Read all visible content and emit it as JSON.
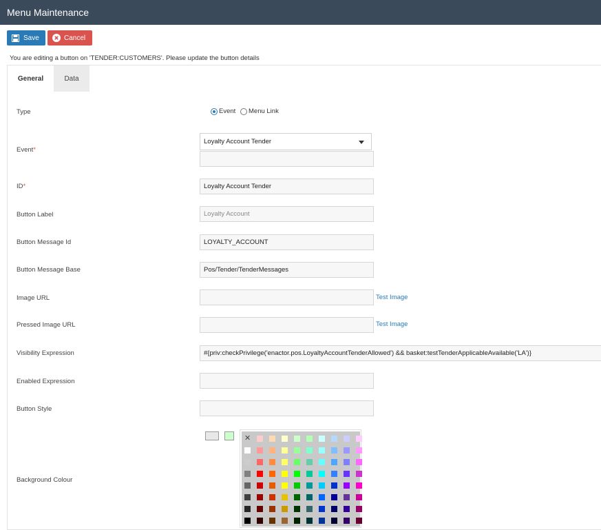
{
  "window": {
    "title": "Menu Maintenance"
  },
  "toolbar": {
    "save_label": "Save",
    "cancel_label": "Cancel"
  },
  "notice": "You are editing a button on 'TENDER:CUSTOMERS'. Please update the button details",
  "tabs": [
    {
      "label": "General",
      "active": true
    },
    {
      "label": "Data",
      "active": false
    }
  ],
  "form": {
    "type": {
      "label": "Type",
      "options": [
        "Event",
        "Menu Link"
      ],
      "selected": "Event"
    },
    "event": {
      "label": "Event",
      "required": "*",
      "selected": "Loyalty Account Tender",
      "sub_value": ""
    },
    "id": {
      "label": "ID",
      "required": "*",
      "value": "Loyalty Account Tender"
    },
    "button_label": {
      "label": "Button Label",
      "placeholder": "Loyalty Account",
      "value": ""
    },
    "button_message_id": {
      "label": "Button Message Id",
      "value": "LOYALTY_ACCOUNT"
    },
    "button_message_base": {
      "label": "Button Message Base",
      "value": "Pos/Tender/TenderMessages"
    },
    "image_url": {
      "label": "Image URL",
      "value": "",
      "test_link": "Test Image"
    },
    "pressed_image_url": {
      "label": "Pressed Image URL",
      "value": "",
      "test_link": "Test Image"
    },
    "visibility_expression": {
      "label": "Visibility Expression",
      "value": "#{priv:checkPrivilege('enactor.pos.LoyaltyAccountTenderAllowed') && basket:testTenderApplicableAvailable('LA')}"
    },
    "enabled_expression": {
      "label": "Enabled Expression",
      "value": ""
    },
    "button_style": {
      "label": "Button Style",
      "value": ""
    },
    "background_colour": {
      "label": "Background Colour",
      "current_swatches": [
        "#e8e8e8",
        "#ccffcc"
      ]
    }
  },
  "palette": {
    "rows": [
      [
        "none",
        "#ffcccc",
        "#ffd9b3",
        "#ffffcc",
        "#ccffcc",
        "#b3ffb3",
        "#ccffff",
        "#b3d9ff",
        "#ccccff",
        "#ffccff"
      ],
      [
        "#ffffff",
        "#ff9999",
        "#ffb380",
        "#ffff99",
        "#99ff99",
        "#80ffcc",
        "#99ffff",
        "#80bfff",
        "#9999ff",
        "#ff99ff"
      ],
      [
        "#cccccc",
        "#ff6666",
        "#ff8c40",
        "#ffff66",
        "#66ff66",
        "#66ccaa",
        "#66ffff",
        "#4da6ff",
        "#8080ff",
        "#ff66ff"
      ],
      [
        "#808080",
        "#ff0000",
        "#ff6600",
        "#ffff00",
        "#00ff00",
        "#00cc99",
        "#00ffff",
        "#3380ff",
        "#6633ff",
        "#cc33cc"
      ],
      [
        "#666666",
        "#cc0000",
        "#e65c00",
        "#ffff00",
        "#00cc00",
        "#009999",
        "#00ccff",
        "#0033cc",
        "#9900ff",
        "#ff00cc"
      ],
      [
        "#404040",
        "#990000",
        "#cc3300",
        "#e6c200",
        "#006600",
        "#006666",
        "#0066ff",
        "#000099",
        "#663399",
        "#cc0099"
      ],
      [
        "#262626",
        "#660000",
        "#993300",
        "#cc9900",
        "#003300",
        "#336666",
        "#0033cc",
        "#000066",
        "#330099",
        "#990066"
      ],
      [
        "#000000",
        "#330000",
        "#663300",
        "#996633",
        "#002200",
        "#003333",
        "#003399",
        "#000033",
        "#330066",
        "#660033"
      ]
    ]
  }
}
